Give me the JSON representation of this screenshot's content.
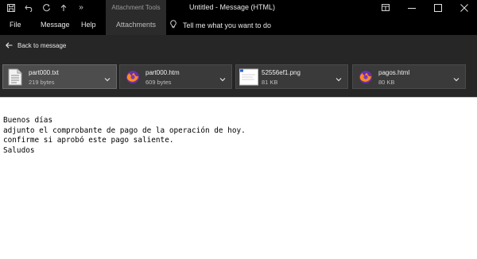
{
  "window": {
    "title": "Untitled  -  Message (HTML)",
    "context_tab": "Attachment Tools"
  },
  "quick_access": {
    "icons": [
      "save-icon",
      "undo-icon",
      "redo-icon",
      "up-icon",
      "more-icon"
    ],
    "more_glyph": "»"
  },
  "ribbon": {
    "tabs": [
      {
        "label": "File"
      },
      {
        "label": "Message"
      },
      {
        "label": "Help"
      },
      {
        "label": "Attachments"
      }
    ],
    "tell_me": "Tell me what you want to do"
  },
  "back": {
    "label": "Back to message"
  },
  "attachments": [
    {
      "name": "part000.txt",
      "size": "219 bytes",
      "icon": "text-file-icon"
    },
    {
      "name": "part000.htm",
      "size": "609 bytes",
      "icon": "firefox-icon"
    },
    {
      "name": "52556ef1.png",
      "size": "81 KB",
      "icon": "image-thumbnail-icon"
    },
    {
      "name": "pagos.html",
      "size": "80 KB",
      "icon": "firefox-icon"
    }
  ],
  "message": {
    "lines": [
      "Buenos días",
      "adjunto el comprobante de pago de la operación de hoy.",
      "confirme si aprobó este pago saliente.",
      "Saludos"
    ]
  },
  "colors": {
    "titlebar": "#000000",
    "panel": "#262626",
    "attachment_tile": "#3a3a3a",
    "body": "#ffffff"
  }
}
